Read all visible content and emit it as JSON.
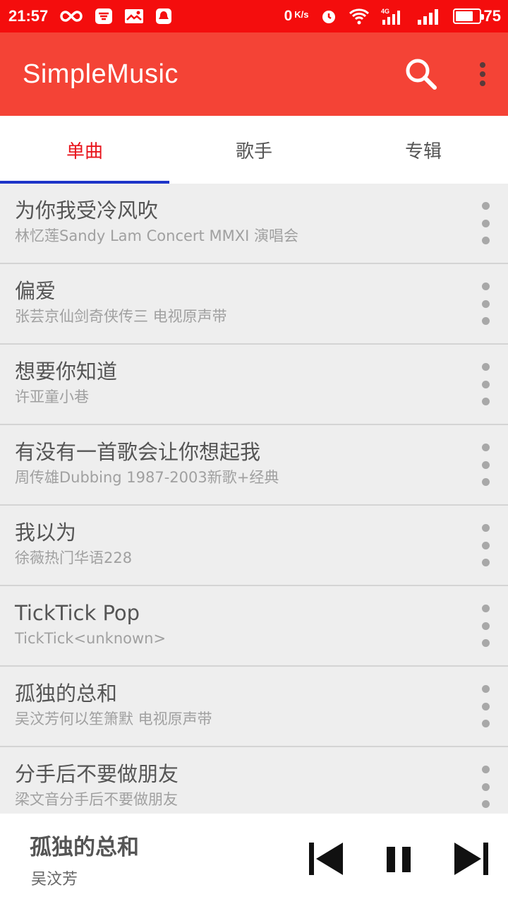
{
  "status_bar": {
    "time": "21:57",
    "net_speed": "0",
    "net_speed_unit": "K/s",
    "battery_level": "75",
    "icons": [
      "infinity-icon",
      "app-notification-icon",
      "mail-notification-icon",
      "qq-icon",
      "alarm-icon",
      "wifi-icon",
      "signal-4g-icon",
      "signal-icon",
      "battery-icon"
    ]
  },
  "app_bar": {
    "title": "SimpleMusic",
    "actions": [
      "search-icon",
      "overflow-menu-icon"
    ]
  },
  "tabs": [
    {
      "label": "单曲",
      "active": true
    },
    {
      "label": "歌手",
      "active": false
    },
    {
      "label": "专辑",
      "active": false
    }
  ],
  "songs": [
    {
      "title": "为你我受冷风吹",
      "subtitle": "林忆莲Sandy Lam Concert MMXI 演唱会"
    },
    {
      "title": "偏爱",
      "subtitle": "张芸京仙剑奇侠传三 电视原声带"
    },
    {
      "title": "想要你知道",
      "subtitle": "许亚童小巷"
    },
    {
      "title": "有没有一首歌会让你想起我",
      "subtitle": "周传雄Dubbing 1987-2003新歌+经典"
    },
    {
      "title": "我以为",
      "subtitle": "徐薇热门华语228"
    },
    {
      "title": "TickTick Pop",
      "subtitle": "TickTick<unknown>"
    },
    {
      "title": "孤独的总和",
      "subtitle": "吴汶芳何以笙箫默 电视原声带"
    },
    {
      "title": "分手后不要做朋友",
      "subtitle": "梁文音分手后不要做朋友"
    }
  ],
  "player": {
    "title": "孤独的总和",
    "artist": "吴汶芳",
    "controls": [
      "previous-icon",
      "pause-icon",
      "next-icon"
    ]
  },
  "colors": {
    "status_bar": "#f40d0d",
    "app_bar": "#f44336",
    "active_tab_text": "#e8141c",
    "tab_indicator": "#1e35c8",
    "list_background": "#eeeeee"
  }
}
